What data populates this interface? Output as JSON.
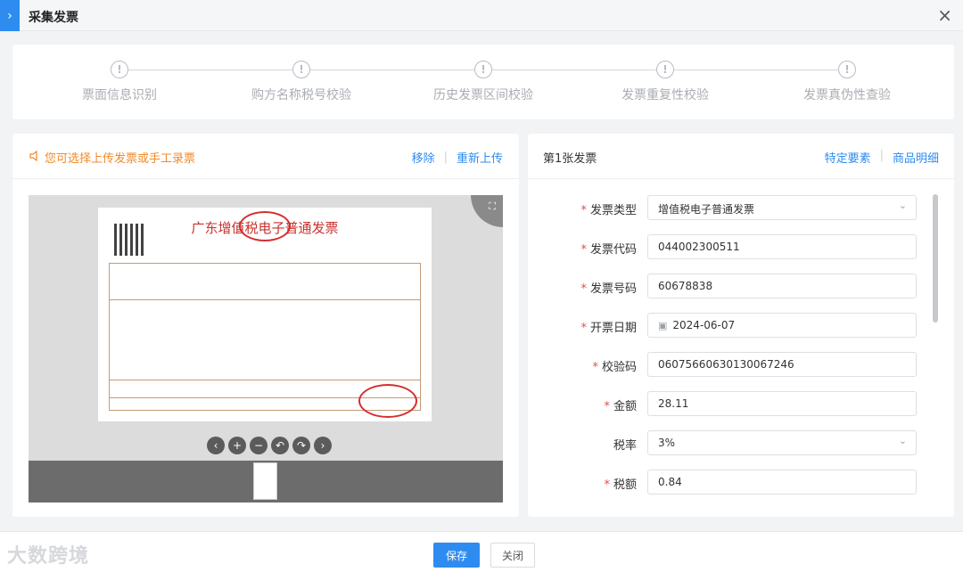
{
  "titlebar": {
    "title": "采集发票",
    "toggle_icon": "chevron-right-icon",
    "close_icon": "close-icon"
  },
  "steps": [
    {
      "label": "票面信息识别",
      "icon": "exclamation-circle-icon"
    },
    {
      "label": "购方名称税号校验",
      "icon": "exclamation-circle-icon"
    },
    {
      "label": "历史发票区间校验",
      "icon": "exclamation-circle-icon"
    },
    {
      "label": "发票重复性校验",
      "icon": "exclamation-circle-icon"
    },
    {
      "label": "发票真伪性查验",
      "icon": "exclamation-circle-icon"
    }
  ],
  "left": {
    "hint": "您可选择上传发票或手工录票",
    "remove": "移除",
    "reupload": "重新上传",
    "invoice_title": "广东增值税电子普通发票"
  },
  "right": {
    "title": "第1张发票",
    "special": "特定要素",
    "goods": "商品明细",
    "fields": {
      "type": {
        "label": "发票类型",
        "value": "增值税电子普通发票"
      },
      "code": {
        "label": "发票代码",
        "value": "044002300511"
      },
      "number": {
        "label": "发票号码",
        "value": "60678838"
      },
      "date": {
        "label": "开票日期",
        "value": "2024-06-07"
      },
      "check": {
        "label": "校验码",
        "value": "06075660630130067246"
      },
      "amount": {
        "label": "金额",
        "value": "28.11"
      },
      "rate": {
        "label": "税率",
        "value": "3%"
      },
      "tax": {
        "label": "税额",
        "value": "0.84"
      }
    }
  },
  "footer": {
    "save": "保存",
    "close": "关闭"
  },
  "watermark": "大数跨境",
  "colors": {
    "primary": "#2e8cf0",
    "warning": "#f08a2b",
    "required": "#e14d4d"
  }
}
